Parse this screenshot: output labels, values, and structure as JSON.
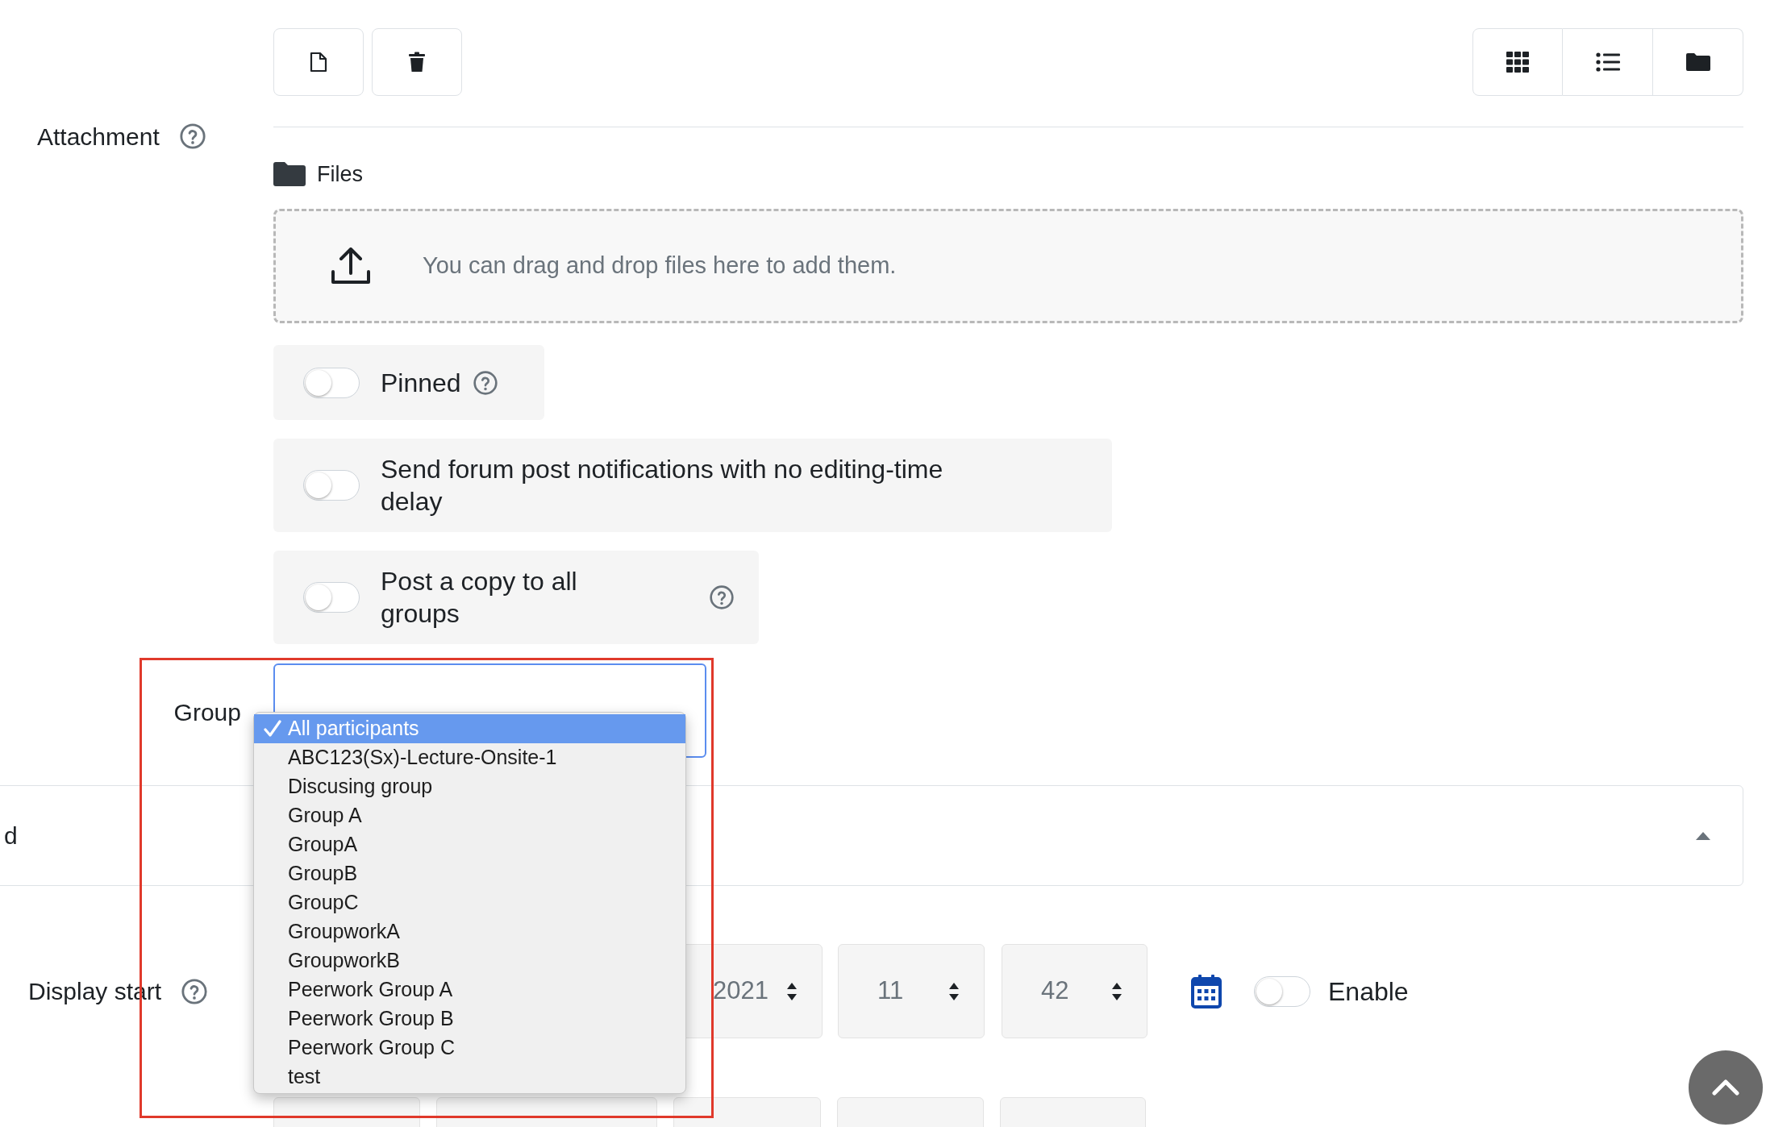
{
  "attachment": {
    "label": "Attachment",
    "files_label": "Files",
    "dropzone_text": "You can drag and drop files here to add them."
  },
  "toggles": [
    {
      "label": "Pinned",
      "on": false,
      "help": true
    },
    {
      "label": "Send forum post notifications with no editing-time delay",
      "on": false,
      "help": false
    },
    {
      "label": "Post a copy to all groups",
      "on": false,
      "help": true
    }
  ],
  "group": {
    "label": "Group",
    "options": [
      {
        "label": "All participants",
        "selected": true
      },
      {
        "label": "ABC123(Sx)-Lecture-Onsite-1",
        "selected": false
      },
      {
        "label": "Discusing group",
        "selected": false
      },
      {
        "label": "Group A",
        "selected": false
      },
      {
        "label": "GroupA",
        "selected": false
      },
      {
        "label": "GroupB",
        "selected": false
      },
      {
        "label": "GroupC",
        "selected": false
      },
      {
        "label": "GroupworkA",
        "selected": false
      },
      {
        "label": "GroupworkB",
        "selected": false
      },
      {
        "label": "Peerwork Group A",
        "selected": false
      },
      {
        "label": "Peerwork Group B",
        "selected": false
      },
      {
        "label": "Peerwork Group C",
        "selected": false
      },
      {
        "label": "test",
        "selected": false
      }
    ]
  },
  "section": {
    "title": "d"
  },
  "display_start": {
    "label": "Display start",
    "year": "2021",
    "hour": "11",
    "minute": "42",
    "enable_label": "Enable",
    "enabled": false
  }
}
